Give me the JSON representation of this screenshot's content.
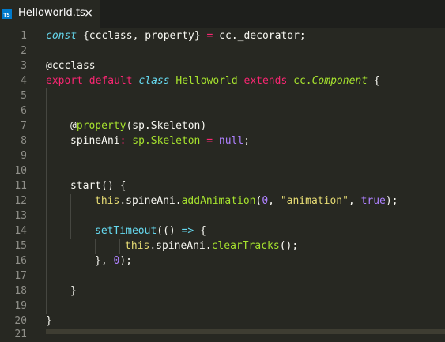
{
  "tab": {
    "label": "Helloworld.ts",
    "icon": "typescript-file-icon",
    "icon_text": "TS",
    "close": "×"
  },
  "colors": {
    "background": "#272822",
    "keyword": "#f92672",
    "string": "#e6db74",
    "number": "#ae81ff",
    "function": "#a6e22e",
    "storage": "#66d9ef",
    "text": "#f8f8f2"
  },
  "line_numbers": [
    "1",
    "2",
    "3",
    "4",
    "5",
    "6",
    "7",
    "8",
    "9",
    "10",
    "11",
    "12",
    "13",
    "14",
    "15",
    "16",
    "17",
    "18",
    "19",
    "20",
    "21"
  ],
  "code": {
    "l1": {
      "kw": "const",
      "t1": " {ccclass, property} ",
      "op": "=",
      "t2": " cc._decorator;"
    },
    "l3": {
      "t": "@ccclass"
    },
    "l4": {
      "k1": "export",
      "k2": "default",
      "c1": "class",
      "name": "Helloworld",
      "k3": "extends",
      "ns": "cc",
      "dot": ".",
      "base": "Component",
      "brace": " {"
    },
    "l7": {
      "at": "@",
      "fn": "property",
      "rest": "(sp.Skeleton)"
    },
    "l8": {
      "v": "spineAni",
      "colon": ":",
      "ns": "sp",
      "dot": ".",
      "type": "Skeleton",
      "eq": "=",
      "nul": "null",
      "semi": ";"
    },
    "l11": {
      "t": "start() {"
    },
    "l12": {
      "th": "this",
      "mid": ".spineAni.",
      "fn": "addAnimation",
      "p1": "(",
      "n0": "0",
      "c1": ", ",
      "str": "\"animation\"",
      "c2": ", ",
      "tr": "true",
      "end": ");"
    },
    "l14": {
      "fn": "setTimeout",
      "p": "(() ",
      "arrow": "=>",
      "b": " {"
    },
    "l15": {
      "th": "this",
      "mid": ".spineAni.",
      "fn": "clearTracks",
      "end": "();"
    },
    "l16": {
      "a": "}, ",
      "n0": "0",
      "b": ");"
    },
    "l18": {
      "t": "}"
    },
    "l20": {
      "t": "}"
    }
  }
}
